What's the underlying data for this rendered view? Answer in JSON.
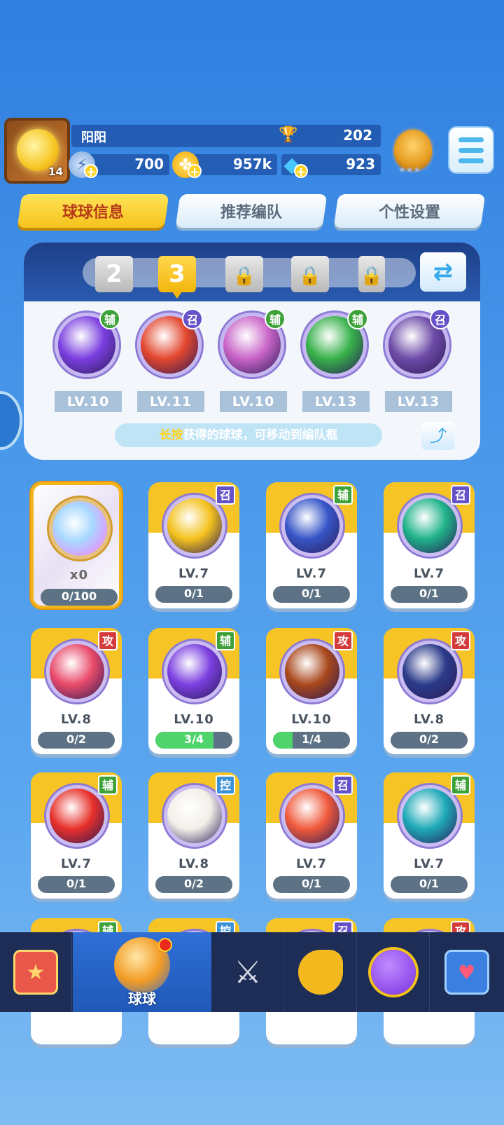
{
  "player": {
    "name": "阳阳",
    "level": "14",
    "trophies": "202",
    "energy": "700",
    "coins": "957k",
    "gems": "923"
  },
  "tabs": [
    {
      "label": "球球信息"
    },
    {
      "label": "推荐编队"
    },
    {
      "label": "个性设置"
    }
  ],
  "team": {
    "slots": [
      "2",
      "3",
      "",
      "",
      ""
    ],
    "active_slot": "3",
    "balls": [
      {
        "type": "辅",
        "level": "LV.10",
        "color": "#7b3fe0"
      },
      {
        "type": "召",
        "level": "LV.11",
        "color": "#e3472e"
      },
      {
        "type": "辅",
        "level": "LV.10",
        "color": "#c964c8"
      },
      {
        "type": "辅",
        "level": "LV.13",
        "color": "#37b24a"
      },
      {
        "type": "召",
        "level": "LV.13",
        "color": "#6e4ba8"
      }
    ],
    "hint_highlight": "长按",
    "hint_text": "获得的球球，可移动到编队框"
  },
  "cards": [
    {
      "type": "",
      "level": "x0",
      "progress": "0/100",
      "fill": 0,
      "color": "#b7dcff"
    },
    {
      "type": "召",
      "level": "LV.7",
      "progress": "0/1",
      "fill": 0,
      "color": "#f4c21e"
    },
    {
      "type": "辅",
      "level": "LV.7",
      "progress": "0/1",
      "fill": 0,
      "color": "#3756c8"
    },
    {
      "type": "召",
      "level": "LV.7",
      "progress": "0/1",
      "fill": 0,
      "color": "#1fb38a"
    },
    {
      "type": "攻",
      "level": "LV.8",
      "progress": "0/2",
      "fill": 0,
      "color": "#e94a6a"
    },
    {
      "type": "辅",
      "level": "LV.10",
      "progress": "3/4",
      "fill": 0.75,
      "color": "#7b3fe0"
    },
    {
      "type": "攻",
      "level": "LV.10",
      "progress": "1/4",
      "fill": 0.25,
      "color": "#a9471c"
    },
    {
      "type": "攻",
      "level": "LV.8",
      "progress": "0/2",
      "fill": 0,
      "color": "#2b3b8a"
    },
    {
      "type": "辅",
      "level": "LV.7",
      "progress": "0/1",
      "fill": 0,
      "color": "#e8302a"
    },
    {
      "type": "控",
      "level": "LV.8",
      "progress": "0/2",
      "fill": 0,
      "color": "#f2efe8"
    },
    {
      "type": "召",
      "level": "LV.7",
      "progress": "0/1",
      "fill": 0,
      "color": "#f05a3c"
    },
    {
      "type": "辅",
      "level": "LV.7",
      "progress": "0/1",
      "fill": 0,
      "color": "#1ea9b8"
    },
    {
      "type": "辅",
      "level": "",
      "progress": "",
      "fill": 0,
      "color": "#f4c21e"
    },
    {
      "type": "控",
      "level": "",
      "progress": "",
      "fill": 0,
      "color": "#f4c21e"
    },
    {
      "type": "召",
      "level": "",
      "progress": "",
      "fill": 0,
      "color": "#f4c21e"
    },
    {
      "type": "攻",
      "level": "",
      "progress": "",
      "fill": 0,
      "color": "#f4c21e"
    }
  ],
  "nav": {
    "items": [
      {
        "icon": "shop-icon",
        "label": ""
      },
      {
        "icon": "balls-icon",
        "label": "球球"
      },
      {
        "icon": "battle-swords-icon",
        "label": ""
      },
      {
        "icon": "whistle-icon",
        "label": ""
      },
      {
        "icon": "planet-icon",
        "label": ""
      },
      {
        "icon": "social-chat-icon",
        "label": ""
      }
    ]
  }
}
